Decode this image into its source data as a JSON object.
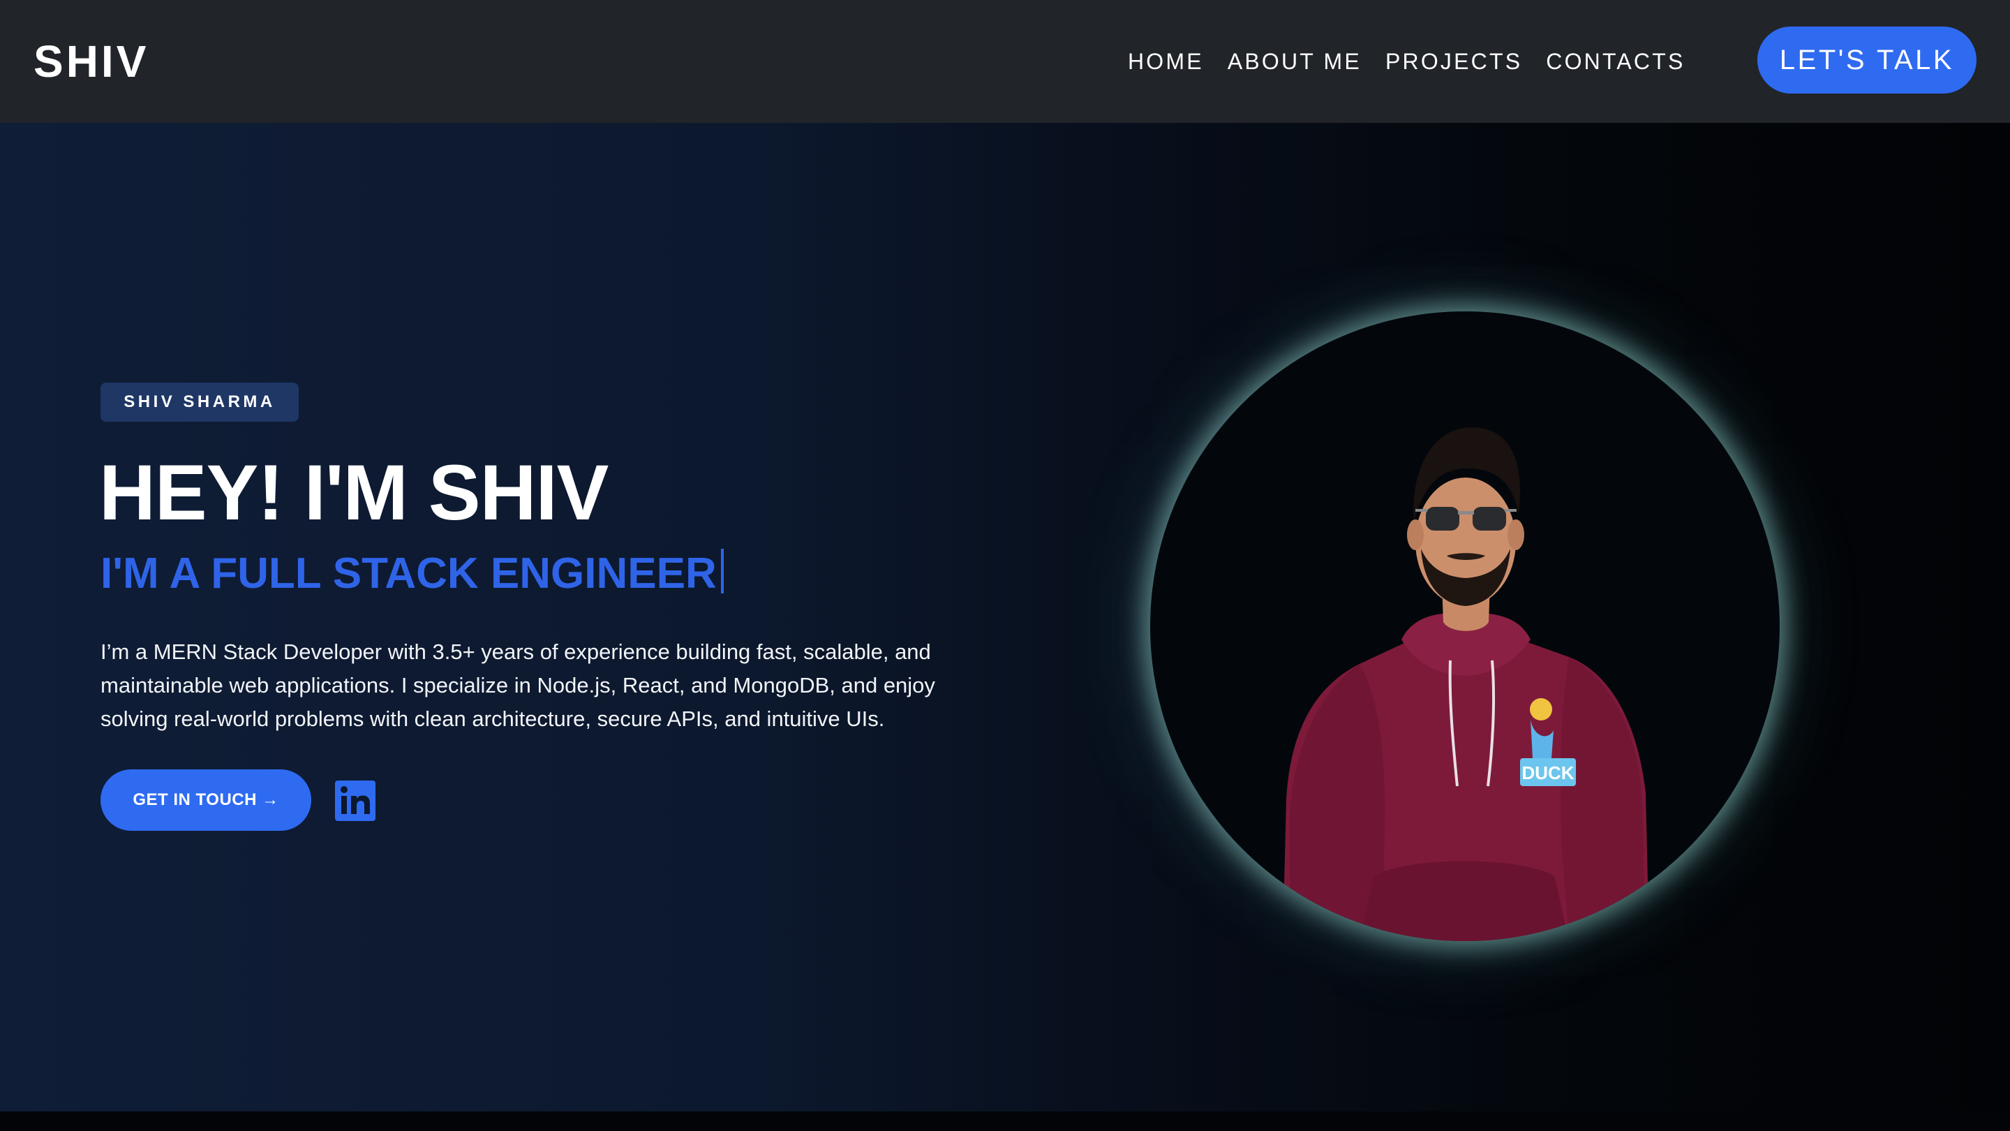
{
  "header": {
    "logo": "SHIV",
    "nav": [
      "HOME",
      "ABOUT ME",
      "PROJECTS",
      "CONTACTS"
    ],
    "cta_label": "LET'S TALK"
  },
  "hero": {
    "badge": "SHIV SHARMA",
    "headline": "HEY! I'M SHIV",
    "subheadline": "I'M A FULL STACK ENGINEER",
    "intro": "I’m a MERN Stack Developer with 3.5+ years of experience building fast, scalable, and maintainable web applications. I specialize in Node.js, React, and MongoDB, and enjoy solving real-world problems with clean architecture, secure APIs, and intuitive UIs.",
    "button_label": "GET IN TOUCH →",
    "social_icon": "linkedin-icon",
    "photo_logo_text": "DUCK"
  },
  "colors": {
    "navbar_bg": "#212429",
    "accent_blue": "#2f6bf1",
    "badge_bg": "#1f3765",
    "glow": "#96d7d2"
  }
}
